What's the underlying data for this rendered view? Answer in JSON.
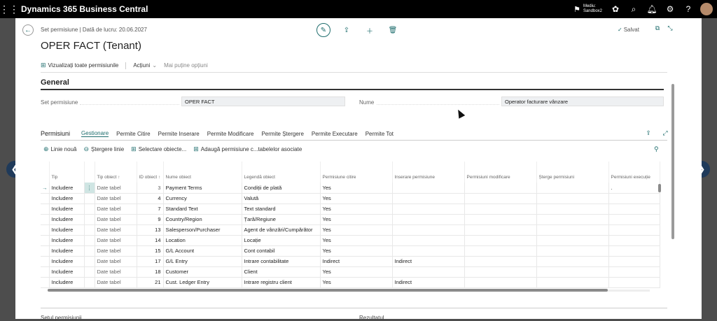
{
  "app": {
    "title": "Dynamics 365 Business Central",
    "environment_line1": "Mediu:",
    "environment_line2": "Sandbox2"
  },
  "header": {
    "breadcrumb": "Set permisiune | Dată de lucru: 20.06.2027",
    "saved_label": "Salvat",
    "page_title": "OPER FACT (Tenant)"
  },
  "actionbar": {
    "view_all": "Vizualizați toate permisiunile",
    "actions": "Acțiuni",
    "fewer_options": "Mai puține opțiuni"
  },
  "general": {
    "heading": "General",
    "set_label": "Set permisiune",
    "set_value": "OPER FACT",
    "name_label": "Nume",
    "name_value": "Operator facturare vânzare"
  },
  "permissions": {
    "title": "Permisiuni",
    "tabs": [
      "Gestionare",
      "Permite Citire",
      "Permite Inserare",
      "Permite Modificare",
      "Permite Ștergere",
      "Permite Executare",
      "Permite Tot"
    ],
    "actions": {
      "new_line": "Linie nouă",
      "delete_line": "Ștergere linie",
      "select_objects": "Selectare obiecte...",
      "add_related": "Adaugă permisiune c...tabelelor asociate"
    },
    "columns": [
      "Tip",
      "Tip obiect ↑",
      "ID obiect ↑",
      "Nume obiect",
      "Legendă obiect",
      "Permisiune citire",
      "Inserare permisiune",
      "Permisiuni modificare",
      "Șterge permisiuni",
      "Permisiuni execuție"
    ],
    "rows": [
      {
        "tip": "Includere",
        "obj_type": "Date tabel",
        "id": "3",
        "name": "Payment Terms",
        "caption": "Condiții de plată",
        "read": "Yes",
        "insert": "",
        "modify": "",
        "delete": "",
        "execute": "."
      },
      {
        "tip": "Includere",
        "obj_type": "Date tabel",
        "id": "4",
        "name": "Currency",
        "caption": "Valută",
        "read": "Yes",
        "insert": "",
        "modify": "",
        "delete": "",
        "execute": ""
      },
      {
        "tip": "Includere",
        "obj_type": "Date tabel",
        "id": "7",
        "name": "Standard Text",
        "caption": "Text standard",
        "read": "Yes",
        "insert": "",
        "modify": "",
        "delete": "",
        "execute": ""
      },
      {
        "tip": "Includere",
        "obj_type": "Date tabel",
        "id": "9",
        "name": "Country/Region",
        "caption": "Țară/Regiune",
        "read": "Yes",
        "insert": "",
        "modify": "",
        "delete": "",
        "execute": ""
      },
      {
        "tip": "Includere",
        "obj_type": "Date tabel",
        "id": "13",
        "name": "Salesperson/Purchaser",
        "caption": "Agent de vânzări/Cumpărător",
        "read": "Yes",
        "insert": "",
        "modify": "",
        "delete": "",
        "execute": ""
      },
      {
        "tip": "Includere",
        "obj_type": "Date tabel",
        "id": "14",
        "name": "Location",
        "caption": "Locație",
        "read": "Yes",
        "insert": "",
        "modify": "",
        "delete": "",
        "execute": ""
      },
      {
        "tip": "Includere",
        "obj_type": "Date tabel",
        "id": "15",
        "name": "G/L Account",
        "caption": "Cont contabil",
        "read": "Yes",
        "insert": "",
        "modify": "",
        "delete": "",
        "execute": ""
      },
      {
        "tip": "Includere",
        "obj_type": "Date tabel",
        "id": "17",
        "name": "G/L Entry",
        "caption": "Intrare contabilitate",
        "read": "Indirect",
        "insert": "Indirect",
        "modify": "",
        "delete": "",
        "execute": ""
      },
      {
        "tip": "Includere",
        "obj_type": "Date tabel",
        "id": "18",
        "name": "Customer",
        "caption": "Client",
        "read": "Yes",
        "insert": "",
        "modify": "",
        "delete": "",
        "execute": ""
      },
      {
        "tip": "Includere",
        "obj_type": "Date tabel",
        "id": "21",
        "name": "Cust. Ledger Entry",
        "caption": "Intrare registru client",
        "read": "Yes",
        "insert": "Indirect",
        "modify": "",
        "delete": "",
        "execute": ""
      }
    ]
  },
  "footer": {
    "left": "Setul permisiunii",
    "right": "Rezultatul"
  },
  "colors": {
    "accent": "#1f6e6e",
    "topbar": "#000000",
    "overlay": "#4d4d4d"
  }
}
